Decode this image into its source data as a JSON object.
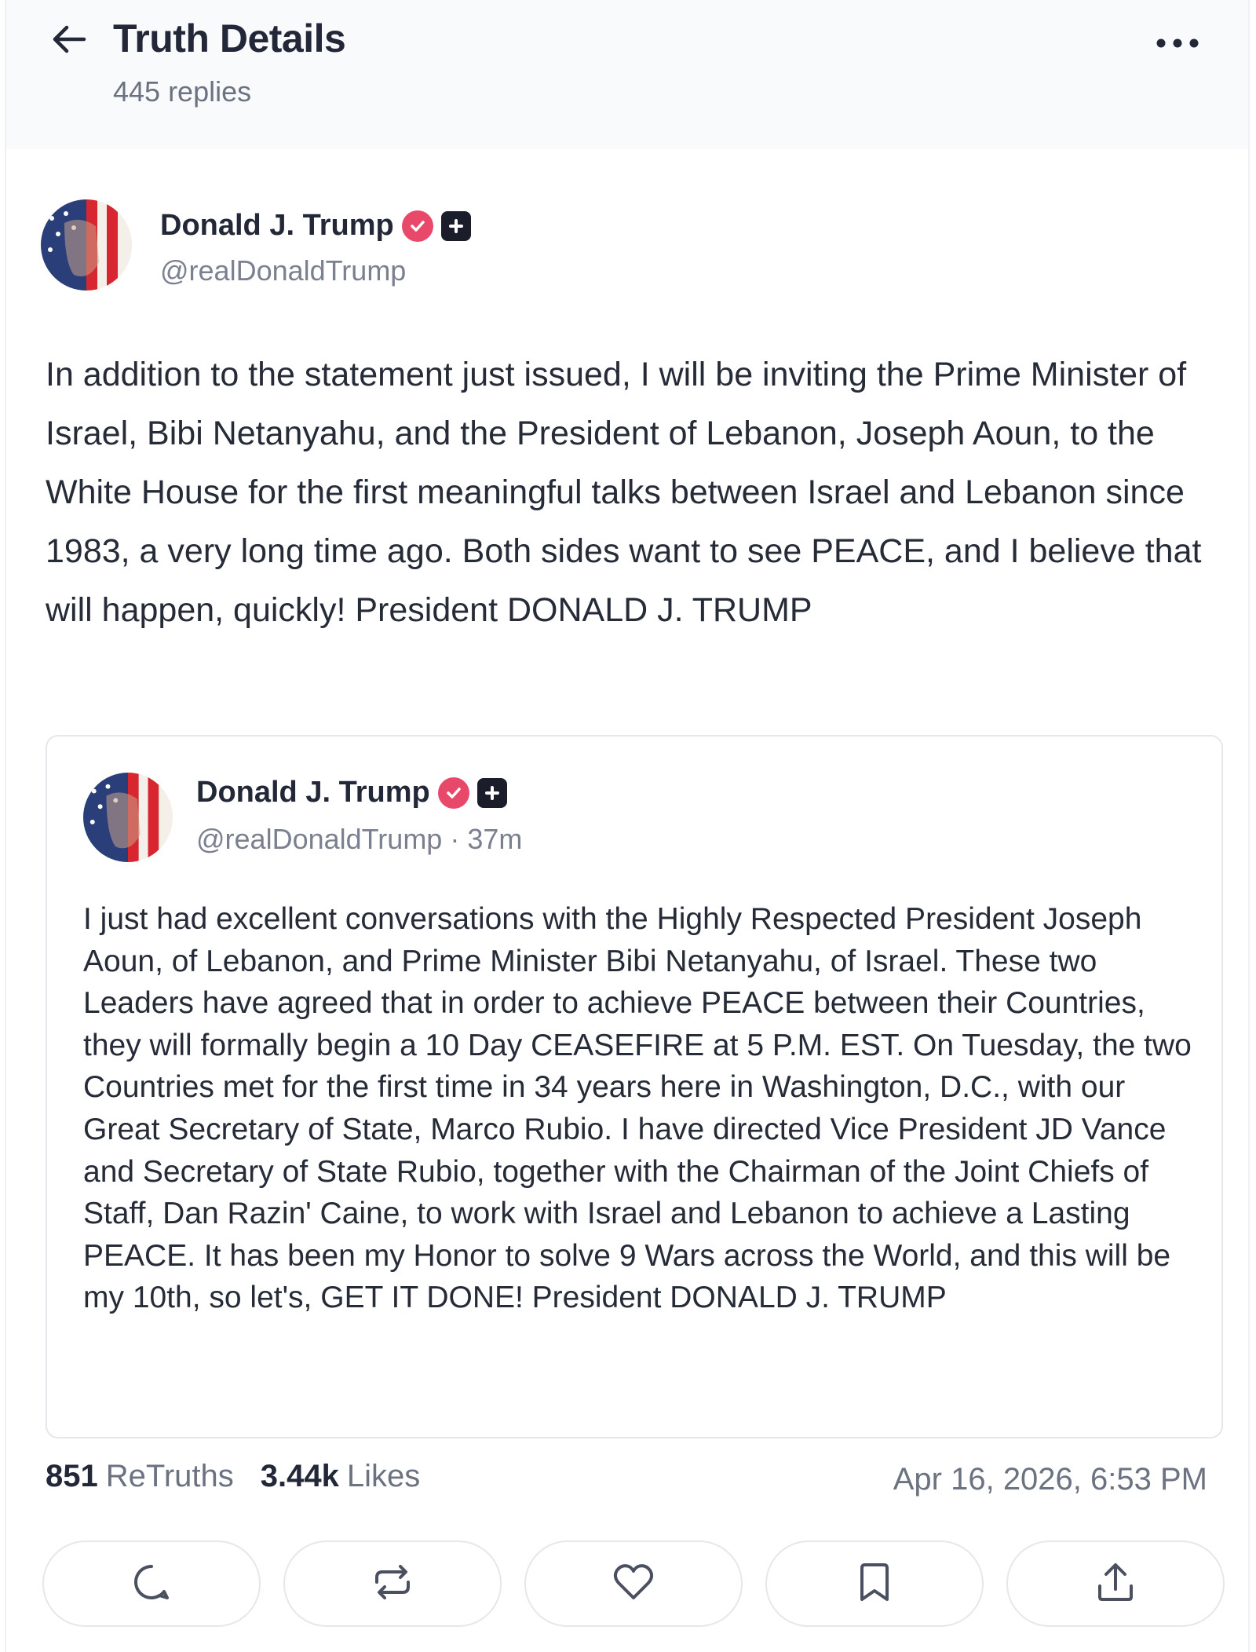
{
  "header": {
    "title": "Truth Details",
    "replies": "445 replies",
    "back_icon": "arrow-left-icon",
    "more_icon": "more-horizontal-icon"
  },
  "post": {
    "author_name": "Donald J. Trump",
    "author_handle": "@realDonaldTrump",
    "text": "In addition to the statement just issued, I will be inviting the Prime Minister of Israel, Bibi Netanyahu, and the President of Lebanon, Joseph Aoun, to the White House for the first meaningful talks between Israel and Lebanon since 1983, a very long time ago. Both sides want to see PEACE, and I believe that will happen, quickly! President DONALD J. TRUMP"
  },
  "quote": {
    "author_name": "Donald J. Trump",
    "author_handle": "@realDonaldTrump",
    "time": "· 37m",
    "text": "I just had excellent conversations with the Highly Respected President Joseph Aoun, of Lebanon, and Prime Minister Bibi Netanyahu, of Israel. These two Leaders have agreed that in order to achieve PEACE between their Countries, they will formally begin a 10 Day CEASEFIRE at 5 P.M. EST. On Tuesday, the two Countries met for the first time in 34 years here in Washington, D.C., with our Great Secretary of State, Marco Rubio. I have directed Vice President JD Vance and Secretary of State Rubio, together with the Chairman of the Joint Chiefs of Staff, Dan Razin' Caine, to work with Israel and Lebanon to achieve a Lasting PEACE. It has been my Honor to solve 9 Wars across the World, and this will be my 10th, so let's, GET IT DONE! President DONALD J. TRUMP"
  },
  "stats": {
    "retruths_count": "851",
    "retruths_label": "ReTruths",
    "likes_count": "3.44k",
    "likes_label": "Likes",
    "timestamp": "Apr 16, 2026, 6:53 PM"
  },
  "actions": [
    "reply-icon",
    "retruth-icon",
    "like-icon",
    "bookmark-icon",
    "share-icon"
  ],
  "colors": {
    "verified": "#e8496a",
    "badge": "#1b1e2a",
    "text": "#262b38",
    "muted": "#6b7280"
  }
}
